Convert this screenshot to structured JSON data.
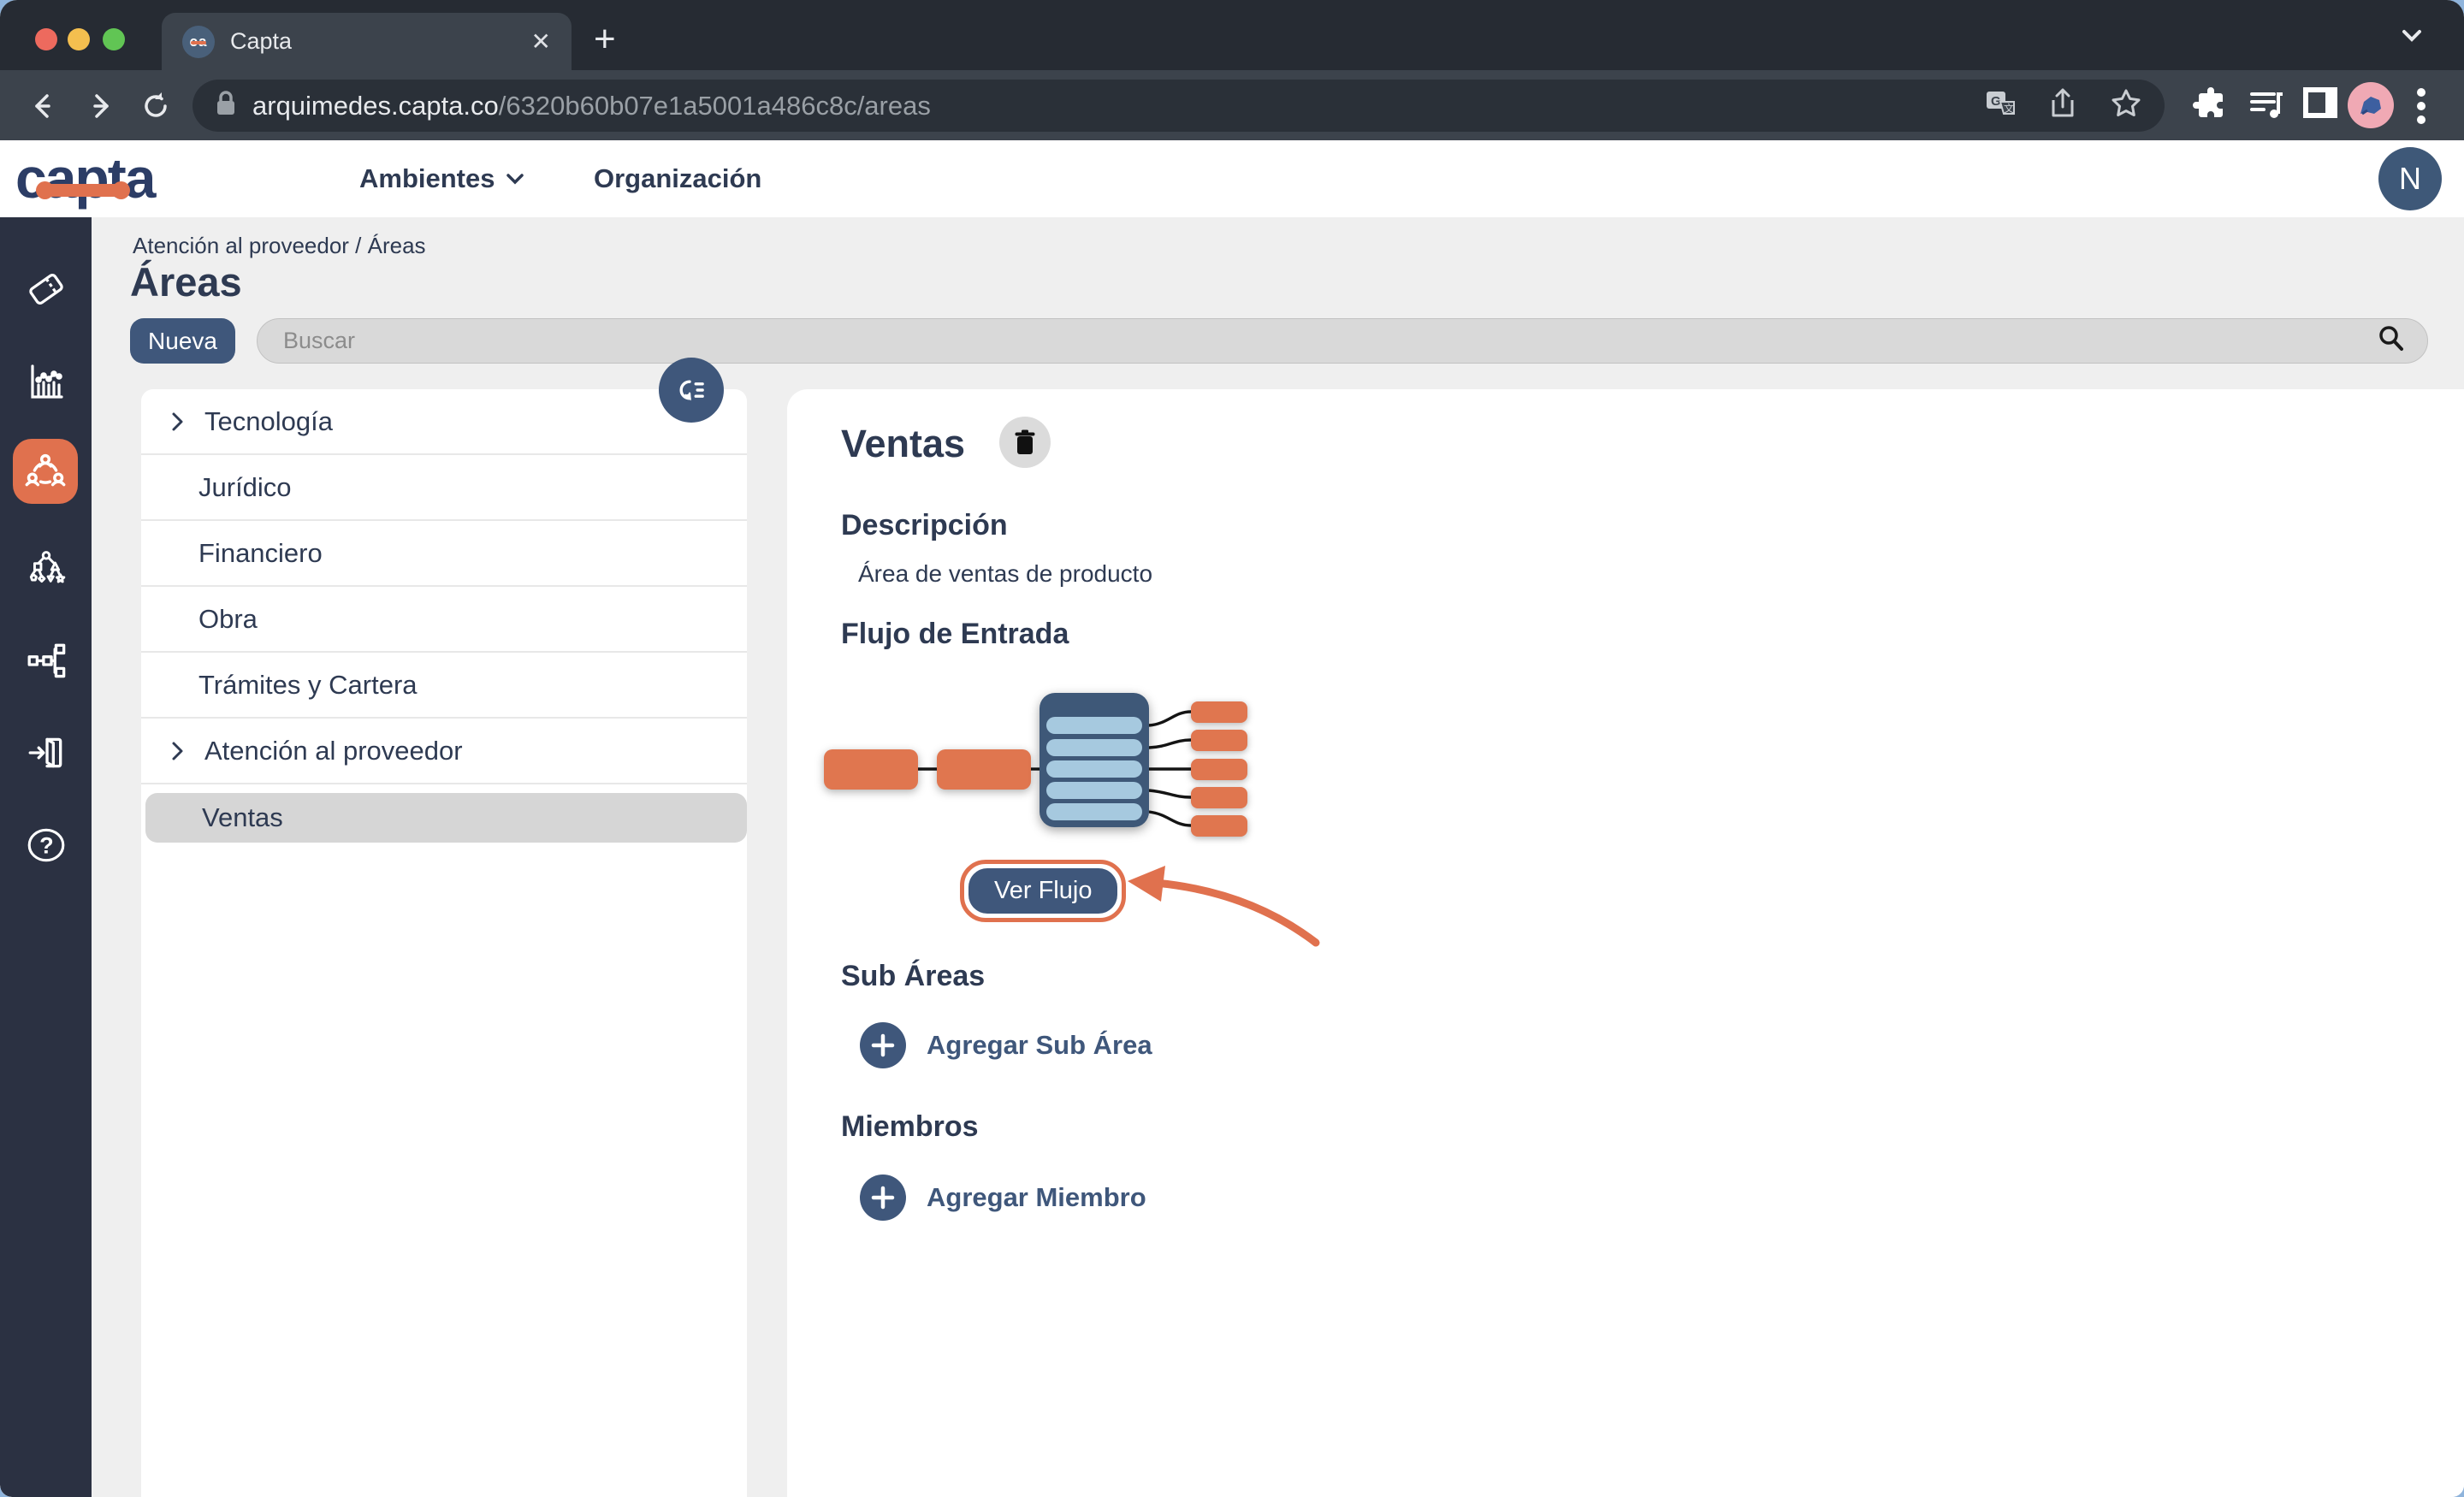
{
  "browser": {
    "tab_title": "Capta",
    "favicon_text": "ca",
    "close_glyph": "✕",
    "new_tab_glyph": "+",
    "url": {
      "domain": "arquimedes.capta.co",
      "path": "/6320b60b07e1a5001a486c8c/areas"
    }
  },
  "header": {
    "logo_text": "capta",
    "nav": {
      "ambientes": "Ambientes",
      "organizacion": "Organización"
    },
    "avatar_initial": "N"
  },
  "page": {
    "breadcrumb": "Atención al proveedor / Áreas",
    "title": "Áreas",
    "new_button_label": "Nueva",
    "search_placeholder": "Buscar",
    "areas": [
      {
        "label": "Tecnología"
      },
      {
        "label": "Jurídico"
      },
      {
        "label": "Financiero"
      },
      {
        "label": "Obra"
      },
      {
        "label": "Trámites y Cartera"
      },
      {
        "label": "Atención al proveedor"
      },
      {
        "label": "Ventas"
      }
    ],
    "detail": {
      "title": "Ventas",
      "description_label": "Descripción",
      "description": "Área de ventas de producto",
      "flow_label": "Flujo de Entrada",
      "view_flow_button": "Ver Flujo",
      "subareas_label": "Sub Áreas",
      "add_subarea_label": "Agregar Sub Área",
      "members_label": "Miembros",
      "add_member_label": "Agregar Miembro"
    }
  },
  "colors": {
    "accent_orange": "#E0714E",
    "slate_blue": "#3F577B",
    "navy_text": "#2E3A52",
    "rail_bg": "#2B3142",
    "diagram_navy": "#3E5878",
    "diagram_blue": "#A6C9DF",
    "selected_gray": "#D6D6D6",
    "page_bg": "#EFEFEF",
    "traffic_red": "#ED6A5E",
    "traffic_yellow": "#F4BF4F",
    "traffic_green": "#61C554"
  }
}
